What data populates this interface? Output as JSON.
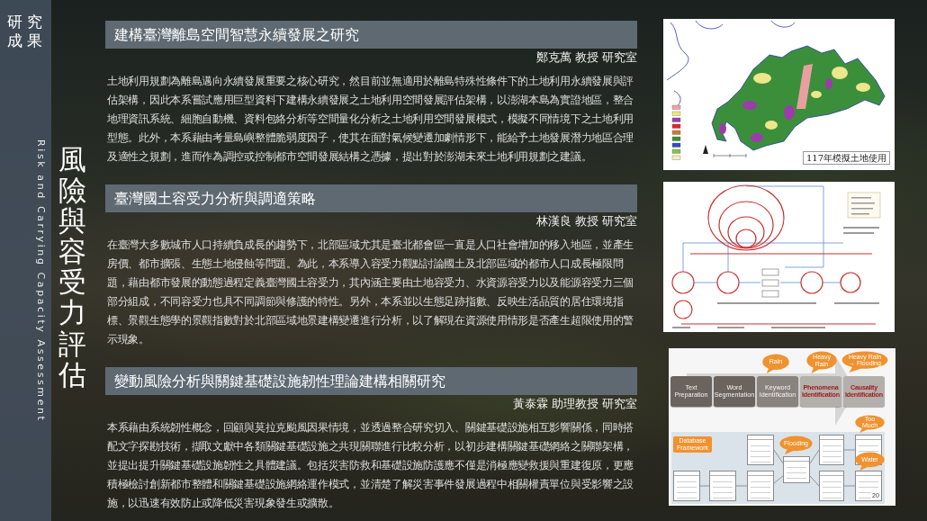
{
  "sidebar": {
    "label": "研究成果",
    "subtitle": "Risk and Carrying Capacity Assessment",
    "title": "風險與容受力評估"
  },
  "projects": [
    {
      "title": "建構臺灣離島空間智慧永續發展之研究",
      "lab": "鄭克萬 教授 研究室",
      "description": "土地利用規劃為離島邁向永續發展重要之核心研究，然目前並無適用於離島特殊性條件下的土地利用永續發展與評估架構，因此本系嘗試應用巨型資料下建構永續發展之土地利用空間發展評估架構，以澎湖本島為實證地區，整合地理資訊系統、細胞自動機、資料包絡分析等空間量化分析之土地利用空間發展模式，模擬不同情境下之土地利用型態。此外，本系藉由考量島嶼整體脆弱度因子，使其在面對氣候變遷加劇情形下，能給予土地發展潛力地區合理及適性之規劃，進而作為調控或控制都市空間發展結構之憑據，提出對於澎湖未來土地利用規劃之建議。"
    },
    {
      "title": "臺灣國土容受力分析與調適策略",
      "lab": "林漢良 教授 研究室",
      "description": "在臺灣大多數城市人口持續負成長的趨勢下，北部區域尤其是臺北都會區一直是人口社會增加的移入地區，並產生房價、都市擴張、生態土地侵蝕等問題。為此，本系導入容受力觀點討論國土及北部區域的都市人口成長極限問題，藉由都市發展的動態過程定義臺灣國土容受力，其內涵主要由土地容受力、水資源容受力以及能源容受力三個部分組成，不同容受力也具不同調節與修護的特性。另外，本系並以生態足跡指數、反映生活品質的居住環境指標、景觀生態學的景觀指數對於北部區域地景建構變遷進行分析，以了解現在資源使用情形是否產生超限使用的警示現象。"
    },
    {
      "title": "變動風險分析與關鍵基礎設施韌性理論建構相關研究",
      "lab": "黃泰霖 助理教授 研究室",
      "description": "本系藉由系統韌性概念，回顧與莫拉克颱風因果情境，並透過整合研究切入、關鍵基礎設施相互影響關係，同時搭配文字探勘技術，擷取文獻中各類關鍵基礎設施之共現關聯進行比較分析，以初步建構關鍵基礎網絡之關聯架構，並提出提升關鍵基礎設施韌性之具體建議。包括災害防救和基礎設施防護應不僅是消極應變救援與重建復原，更應積極檢討創新都市整體和關鍵基礎設施網絡運作模式，並清楚了解災害事件發展過程中相關權責單位與受影響之設施，以迅速有效防止或降低災害現象發生或擴散。"
    }
  ],
  "figures": [
    {
      "kind": "map",
      "caption": "117年模擬土地使用"
    },
    {
      "kind": "diagram"
    },
    {
      "kind": "process",
      "steps": [
        {
          "label": "Text Preparation",
          "highlighted": false
        },
        {
          "label": "Word Segmentation",
          "highlighted": false
        },
        {
          "label": "Keyword Identification",
          "highlighted": false,
          "bubble": "Rain"
        },
        {
          "label": "Phenomena Identification",
          "highlighted": true,
          "bubble": "Heavy Rain"
        },
        {
          "label": "Causality Identification",
          "highlighted": true,
          "bubble": "Heavy Rain → Flooding"
        }
      ],
      "database": {
        "label": "Database Framework",
        "bubbles": [
          "Flooding",
          "Too Much",
          "Water"
        ]
      },
      "page_number": "20"
    }
  ]
}
